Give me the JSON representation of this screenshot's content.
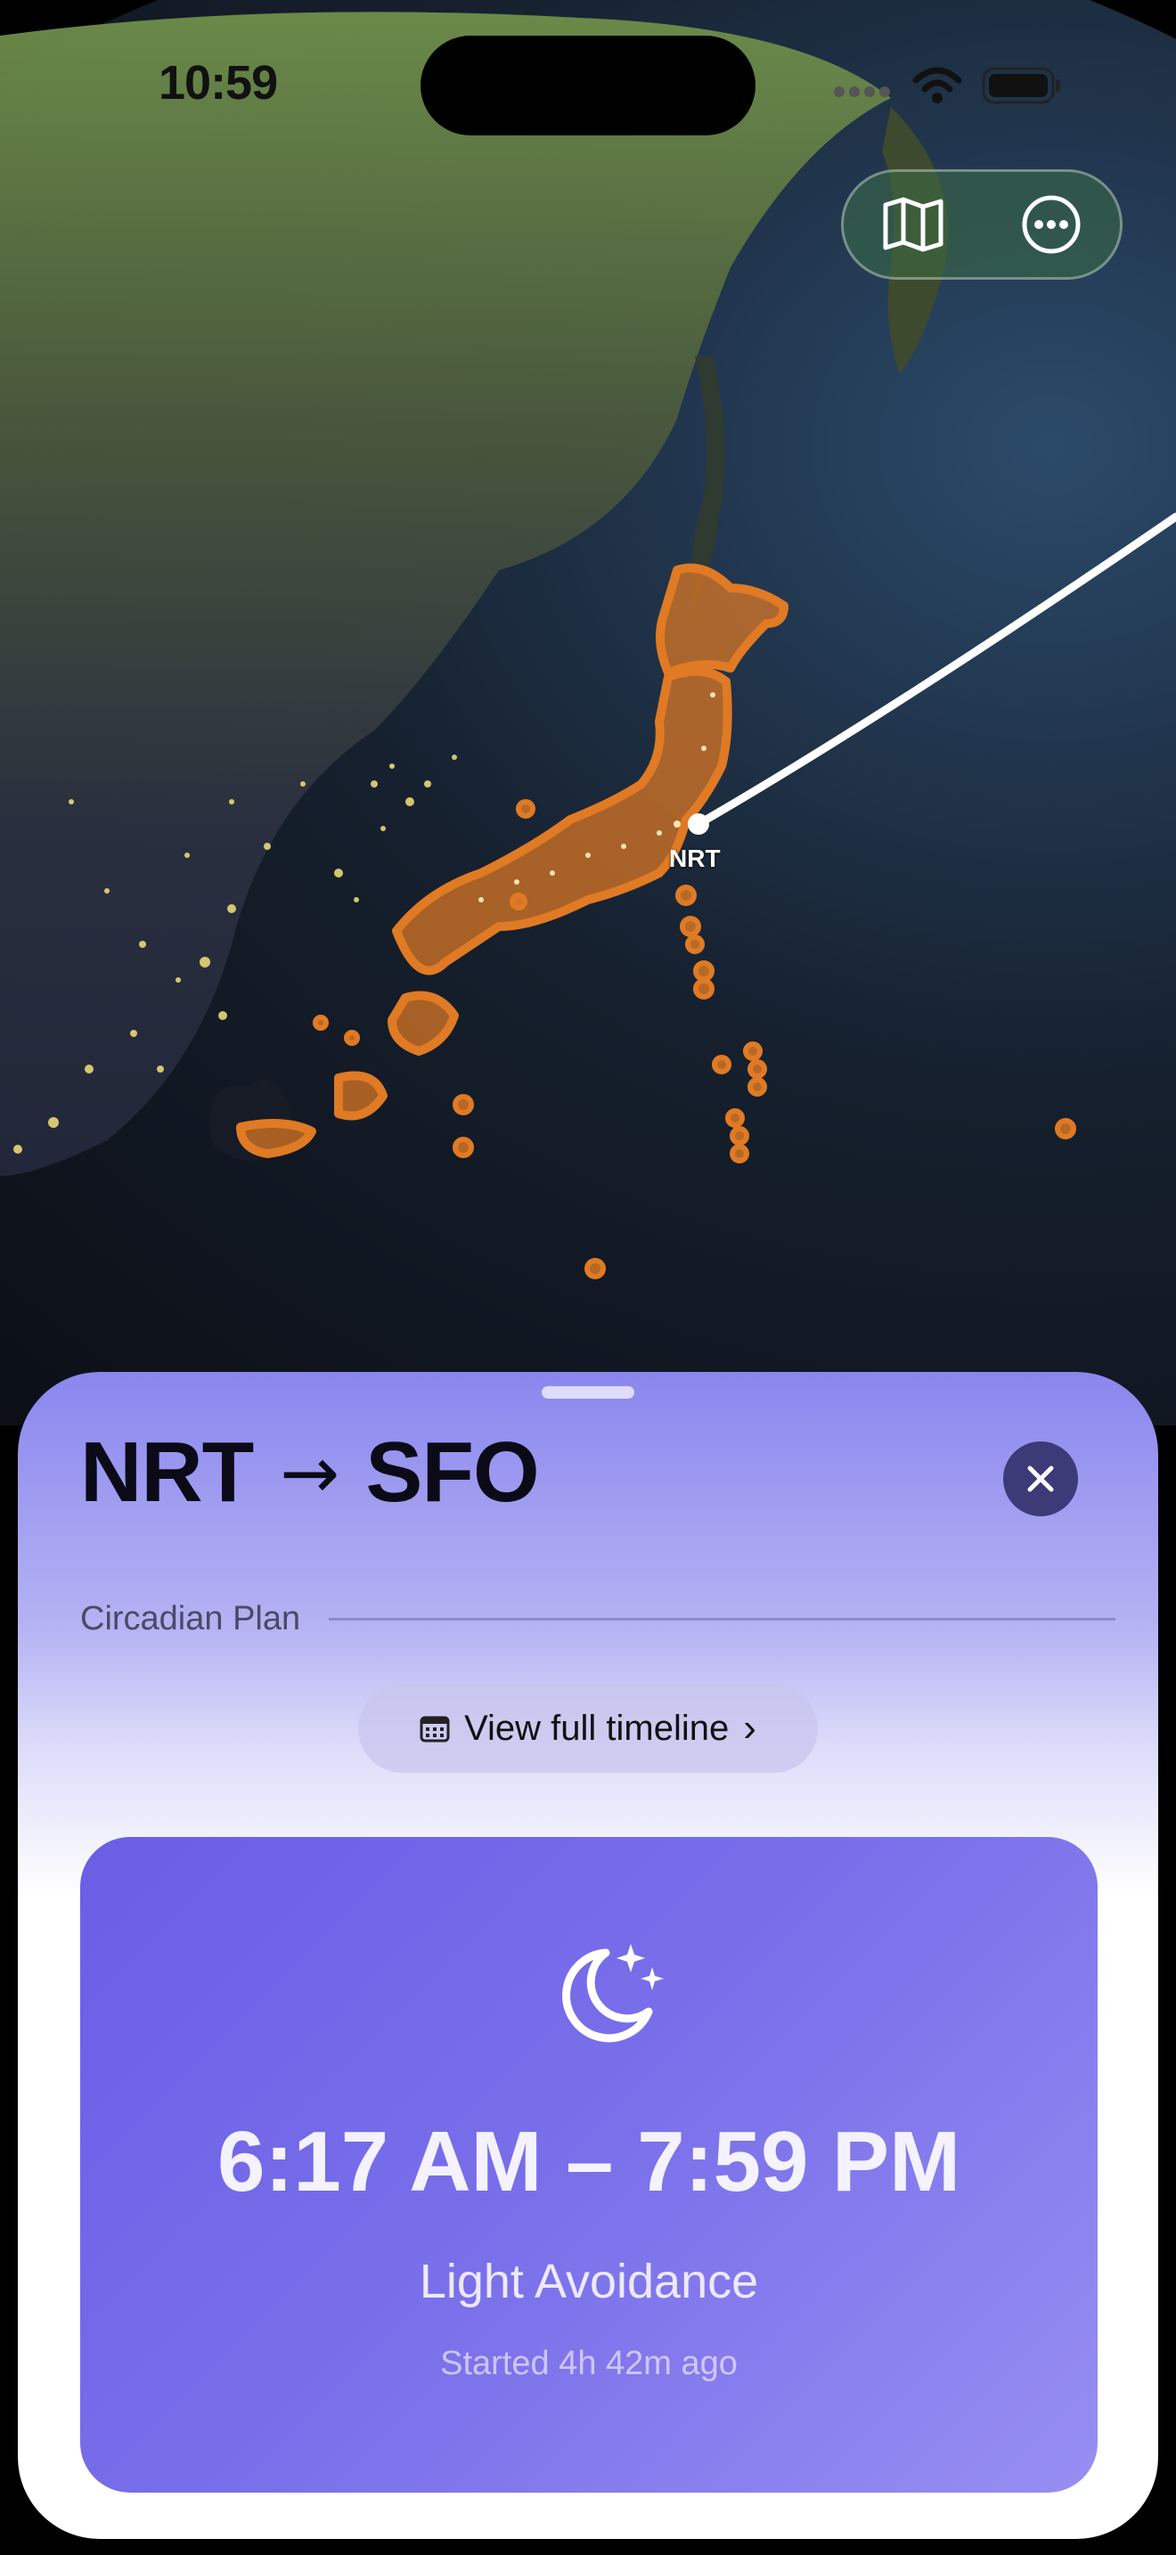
{
  "status_bar": {
    "time": "10:59"
  },
  "map": {
    "origin_marker_label": "NRT",
    "controls": {
      "map_icon": "map-icon",
      "more_icon": "ellipsis-circle-icon"
    }
  },
  "sheet": {
    "route": {
      "origin": "NRT",
      "arrow": "→",
      "destination": "SFO"
    },
    "section_label": "Circadian Plan",
    "timeline_button": {
      "label": "View full timeline",
      "chevron": "›"
    },
    "current_phase": {
      "icon": "moon-stars-icon",
      "time_range": "6:17 AM – 7:59 PM",
      "mode": "Light Avoidance",
      "started": "Started 4h 42m ago"
    }
  },
  "colors": {
    "card_accent": "#6a5ee6",
    "japan_highlight": "#e07a24",
    "close_button": "#3d3a78"
  }
}
